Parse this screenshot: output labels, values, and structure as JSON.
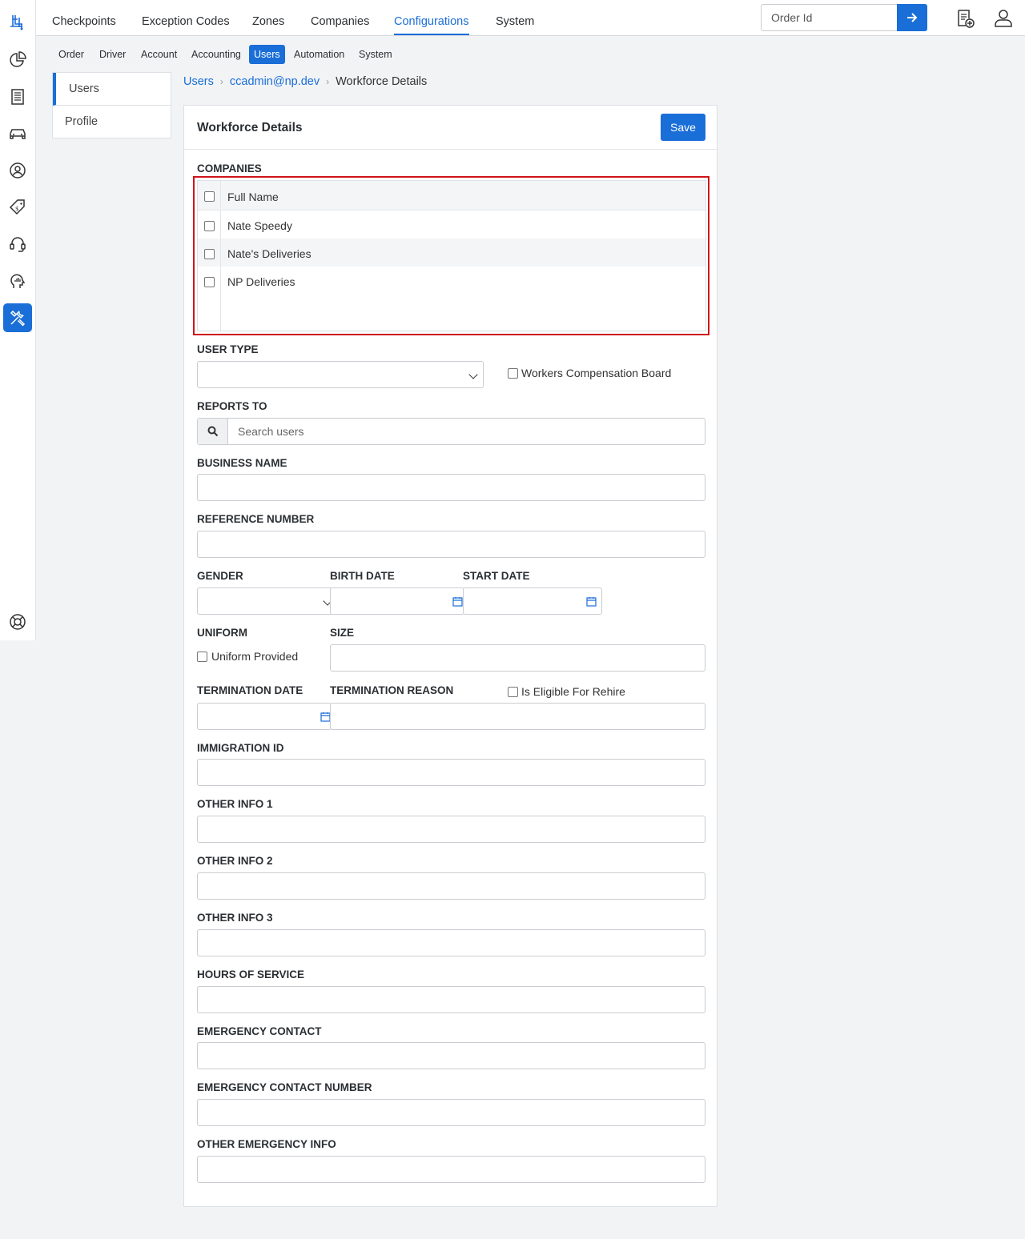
{
  "top_nav": {
    "tabs": [
      {
        "label": "Checkpoints"
      },
      {
        "label": "Exception Codes"
      },
      {
        "label": "Zones"
      },
      {
        "label": "Companies"
      },
      {
        "label": "Configurations"
      },
      {
        "label": "System"
      }
    ],
    "active_tab": "Configurations",
    "order_search_placeholder": "Order Id"
  },
  "sub_nav": {
    "items": [
      {
        "label": "Order"
      },
      {
        "label": "Driver"
      },
      {
        "label": "Account"
      },
      {
        "label": "Accounting"
      },
      {
        "label": "Users"
      },
      {
        "label": "Automation"
      },
      {
        "label": "System"
      }
    ],
    "active_item": "Users"
  },
  "side_menu": {
    "items": [
      {
        "label": "Users"
      },
      {
        "label": "Profile"
      }
    ],
    "active_item": "Users"
  },
  "breadcrumb": {
    "items": [
      {
        "label": "Users"
      },
      {
        "label": "ccadmin@np.dev"
      },
      {
        "label": "Workforce Details"
      }
    ],
    "separator": "›"
  },
  "form": {
    "title": "Workforce Details",
    "save_label": "Save",
    "companies": {
      "label": "COMPANIES",
      "column_header": "Full Name",
      "rows": [
        {
          "name": "Nate Speedy"
        },
        {
          "name": "Nate's Deliveries"
        },
        {
          "name": "NP Deliveries"
        }
      ]
    },
    "user_type_label": "USER TYPE",
    "workers_comp_label": "Workers Compensation Board",
    "reports_to_label": "REPORTS TO",
    "reports_to_placeholder": "Search users",
    "business_name_label": "BUSINESS NAME",
    "reference_number_label": "REFERENCE NUMBER",
    "gender_label": "GENDER",
    "birth_date_label": "BIRTH DATE",
    "start_date_label": "START DATE",
    "uniform_label": "UNIFORM",
    "uniform_provided_label": "Uniform Provided",
    "size_label": "SIZE",
    "termination_date_label": "TERMINATION DATE",
    "termination_reason_label": "TERMINATION REASON",
    "eligible_rehire_label": "Is Eligible For Rehire",
    "immigration_id_label": "IMMIGRATION ID",
    "other_info_1_label": "OTHER INFO 1",
    "other_info_2_label": "OTHER INFO 2",
    "other_info_3_label": "OTHER INFO 3",
    "hours_of_service_label": "HOURS OF SERVICE",
    "emergency_contact_label": "EMERGENCY CONTACT",
    "emergency_contact_number_label": "EMERGENCY CONTACT NUMBER",
    "other_emergency_info_label": "OTHER EMERGENCY INFO"
  },
  "icons": {
    "rail": [
      "app-logo-icon",
      "dashboard-pie-icon",
      "orders-list-icon",
      "vehicle-icon",
      "user-circle-icon",
      "price-tag-icon",
      "support-headset-icon",
      "analytics-head-icon",
      "settings-tools-icon",
      "help-lifebuoy-icon"
    ],
    "top": [
      "arrow-right-icon",
      "add-order-icon",
      "user-profile-icon"
    ]
  },
  "colors": {
    "accent": "#1a6ed8",
    "highlight_border": "#d0131a"
  }
}
